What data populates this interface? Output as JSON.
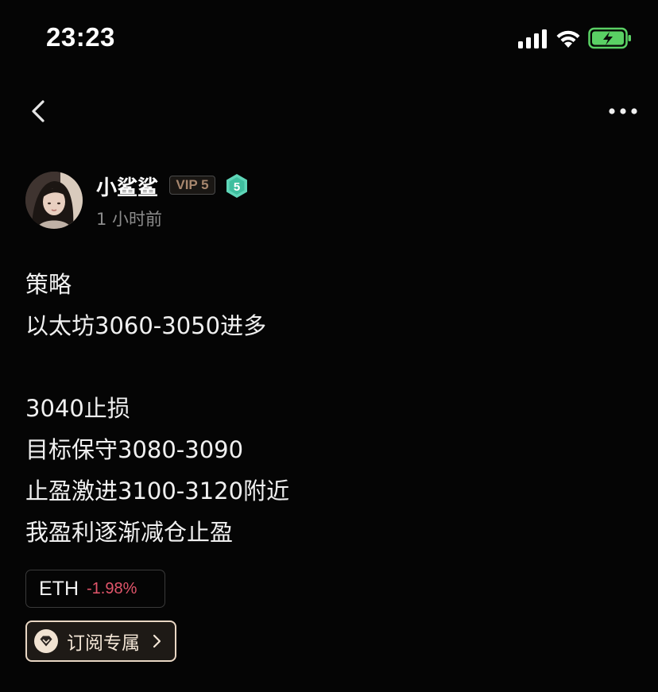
{
  "status_bar": {
    "time": "23:23",
    "icons": [
      "signal-icon",
      "wifi-icon",
      "battery-charging-icon"
    ]
  },
  "nav": {
    "back_icon": "chevron-left-icon",
    "more_icon": "more-horizontal-icon"
  },
  "author": {
    "name": "小鲨鲨",
    "vip_label": "VIP 5",
    "level": "5",
    "post_time": "1 小时前"
  },
  "post": {
    "lines": [
      "策略",
      "以太坊3060-3050进多",
      "",
      "3040止损",
      "目标保守3080-3090",
      "止盈激进3100-3120附近",
      "我盈利逐渐减仓止盈"
    ]
  },
  "coin_tag": {
    "symbol": "ETH",
    "change": "-1.98%",
    "change_color": "#e2556b"
  },
  "subscribe": {
    "label": "订阅专属",
    "icon": "diamond-heart-icon",
    "chevron": "chevron-right-icon"
  },
  "colors": {
    "background": "#050505",
    "accent_gold": "#e9d7c4",
    "badge_green": "#5fd6b8",
    "battery_green": "#5ad064"
  }
}
